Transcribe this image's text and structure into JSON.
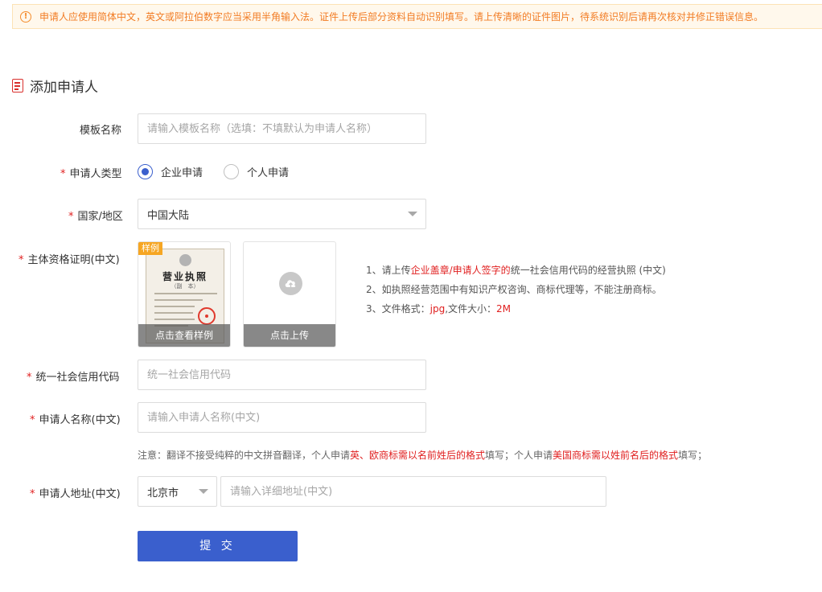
{
  "notice": {
    "icon": "warning-icon",
    "text": "申请人应使用简体中文，英文或阿拉伯数字应当采用半角输入法。证件上传后部分资料自动识别填写。请上传清晰的证件图片，待系统识别后请再次核对并修正错误信息。"
  },
  "section": {
    "icon": "document-icon",
    "title": "添加申请人"
  },
  "form": {
    "template_name": {
      "label": "模板名称",
      "placeholder": "请输入模板名称（选填：不填默认为申请人名称）"
    },
    "applicant_type": {
      "label": "申请人类型",
      "options": [
        "企业申请",
        "个人申请"
      ],
      "selected": "企业申请"
    },
    "region": {
      "label": "国家/地区",
      "value": "中国大陆"
    },
    "qualification": {
      "label": "主体资格证明(中文)",
      "sample_tag": "样例",
      "sample_license_title": "营业执照",
      "sample_license_sub": "（副　本）",
      "sample_button": "点击查看样例",
      "upload_button": "点击上传",
      "tips": {
        "t1_prefix": "1、请上传",
        "t1_red": "企业盖章/申请人签字的",
        "t1_suffix": "统一社会信用代码的经营执照 (中文)",
        "t2": "2、如执照经营范围中有知识产权咨询、商标代理等，不能注册商标。",
        "t3_prefix": "3、文件格式：",
        "t3_format": "jpg",
        "t3_middle": ",文件大小：",
        "t3_size": "2M"
      }
    },
    "credit_code": {
      "label": "统一社会信用代码",
      "placeholder": "统一社会信用代码"
    },
    "applicant_name": {
      "label": "申请人名称(中文)",
      "placeholder": "请输入申请人名称(中文)"
    },
    "name_note": {
      "n1": "注意：翻译不接受纯粹的中文拼音翻译，个人申请",
      "n2": "英、欧商标需以名前姓后的格式",
      "n3": "填写；个人申请",
      "n4": "美国商标需以姓前名后的格式",
      "n5": "填写；"
    },
    "address": {
      "label": "申请人地址(中文)",
      "city": "北京市",
      "placeholder": "请输入详细地址(中文)"
    },
    "submit_label": "提 交"
  },
  "colors": {
    "primary": "#3a5fcd",
    "required_star": "#e02020",
    "warning_text": "#f27c24",
    "warning_bg": "#fff8ec",
    "sample_tag": "#f6a623"
  }
}
